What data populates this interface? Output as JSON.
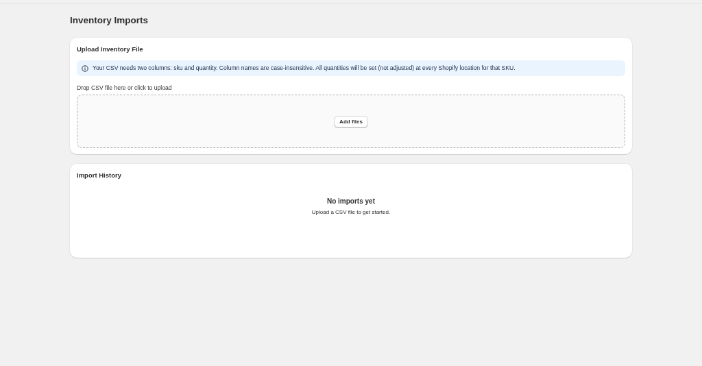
{
  "page": {
    "title": "Inventory Imports"
  },
  "upload_card": {
    "title": "Upload Inventory File",
    "banner": "Your CSV needs two columns: sku and quantity. Column names are case-insensitive. All quantities will be set (not adjusted) at every Shopify location for that SKU.",
    "dropzone_label": "Drop CSV file here or click to upload",
    "button": "Add files"
  },
  "history_card": {
    "title": "Import History",
    "empty_title": "No imports yet",
    "empty_text": "Upload a CSV file to get started."
  }
}
